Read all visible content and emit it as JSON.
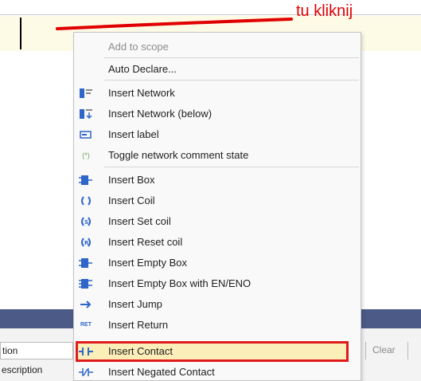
{
  "annotation": {
    "text": "tu kliknij",
    "color": "#e00000"
  },
  "menu": {
    "items": [
      {
        "label": "Add to scope",
        "icon": "none",
        "enabled": false
      },
      {
        "label": "Auto Declare...",
        "icon": "none",
        "enabled": true
      },
      {
        "label": "Insert Network",
        "icon": "insert-network-icon",
        "enabled": true
      },
      {
        "label": "Insert Network (below)",
        "icon": "insert-network-below-icon",
        "enabled": true
      },
      {
        "label": "Insert label",
        "icon": "label-icon",
        "enabled": true
      },
      {
        "label": "Toggle network comment state",
        "icon": "comment-toggle-icon",
        "enabled": true
      },
      {
        "label": "Insert Box",
        "icon": "box-icon",
        "enabled": true
      },
      {
        "label": "Insert Coil",
        "icon": "coil-icon",
        "enabled": true
      },
      {
        "label": "Insert Set coil",
        "icon": "set-coil-icon",
        "enabled": true
      },
      {
        "label": "Insert Reset coil",
        "icon": "reset-coil-icon",
        "enabled": true
      },
      {
        "label": "Insert Empty Box",
        "icon": "empty-box-icon",
        "enabled": true
      },
      {
        "label": "Insert Empty Box with EN/ENO",
        "icon": "empty-box-en-icon",
        "enabled": true
      },
      {
        "label": "Insert Jump",
        "icon": "jump-arrow-icon",
        "enabled": true
      },
      {
        "label": "Insert Return",
        "icon": "return-icon",
        "enabled": true
      },
      {
        "label": "Insert Contact",
        "icon": "contact-icon",
        "enabled": true,
        "highlighted": true
      },
      {
        "label": "Insert Negated Contact",
        "icon": "negated-contact-icon",
        "enabled": true
      }
    ],
    "icon_glyphs": {
      "comment": "(*)",
      "return": "RET",
      "label": "lab"
    }
  },
  "bottom_panel": {
    "field_text": "tion",
    "description_text": "escription",
    "clear_label": "Clear"
  },
  "colors": {
    "highlight_border": "#e01b1b",
    "selected_row": "#fdfbe6",
    "panel_header": "#4b5a86",
    "icon_blue": "#2f66c9"
  }
}
